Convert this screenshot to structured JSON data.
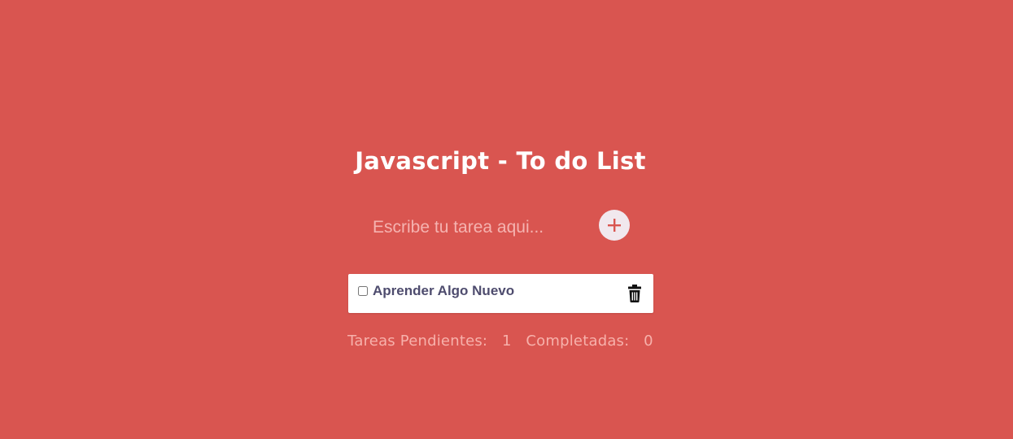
{
  "header": {
    "title": "Javascript - To do List"
  },
  "new_task": {
    "value": "",
    "placeholder": "Escribe tu tarea aqui...",
    "add_icon": "plus-icon"
  },
  "tasks": [
    {
      "label": "Aprender Algo Nuevo",
      "completed": false,
      "delete_icon": "trash-icon"
    }
  ],
  "status": {
    "pending_label": "Tareas Pendientes:",
    "pending_count": "1",
    "completed_label": "Completadas:",
    "completed_count": "0"
  },
  "colors": {
    "background": "#d95550",
    "title": "#ffffff",
    "placeholder": "#f5b3b0",
    "add_button_bg": "#f1e8ee",
    "add_icon": "#d95550",
    "task_text": "#4e4c6e",
    "status_text": "#f7b1ab"
  }
}
